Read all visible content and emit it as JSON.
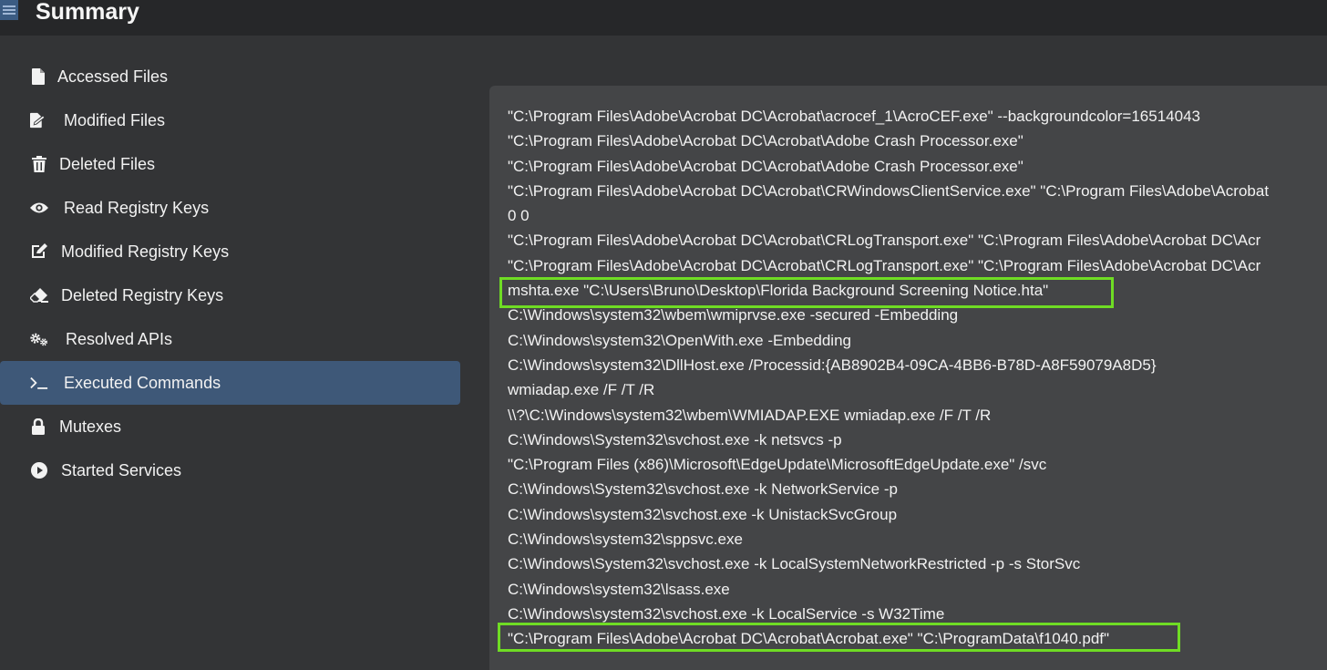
{
  "header": {
    "title": "Summary",
    "menu_icon": "hamburger-menu-icon"
  },
  "sidebar": {
    "items": [
      {
        "label": "Accessed Files",
        "icon": "file-icon"
      },
      {
        "label": "Modified Files",
        "icon": "file-edit-icon"
      },
      {
        "label": "Deleted Files",
        "icon": "trash-icon"
      },
      {
        "label": "Read Registry Keys",
        "icon": "eye-icon"
      },
      {
        "label": "Modified Registry Keys",
        "icon": "pencil-square-icon"
      },
      {
        "label": "Deleted Registry Keys",
        "icon": "eraser-icon"
      },
      {
        "label": "Resolved APIs",
        "icon": "cogs-icon"
      },
      {
        "label": "Executed Commands",
        "icon": "terminal-icon",
        "active": true
      },
      {
        "label": "Mutexes",
        "icon": "lock-icon"
      },
      {
        "label": "Started Services",
        "icon": "play-circle-icon"
      }
    ]
  },
  "commands": [
    "\"C:\\Program Files\\Adobe\\Acrobat DC\\Acrobat\\acrocef_1\\AcroCEF.exe\" --backgroundcolor=16514043",
    "\"C:\\Program Files\\Adobe\\Acrobat DC\\Acrobat\\Adobe Crash Processor.exe\"",
    "\"C:\\Program Files\\Adobe\\Acrobat DC\\Acrobat\\Adobe Crash Processor.exe\"",
    "\"C:\\Program Files\\Adobe\\Acrobat DC\\Acrobat\\CRWindowsClientService.exe\" \"C:\\Program Files\\Adobe\\Acrobat",
    "0 0",
    "\"C:\\Program Files\\Adobe\\Acrobat DC\\Acrobat\\CRLogTransport.exe\" \"C:\\Program Files\\Adobe\\Acrobat DC\\Acr",
    "\"C:\\Program Files\\Adobe\\Acrobat DC\\Acrobat\\CRLogTransport.exe\" \"C:\\Program Files\\Adobe\\Acrobat DC\\Acr",
    "mshta.exe \"C:\\Users\\Bruno\\Desktop\\Florida Background Screening Notice.hta\"",
    "C:\\Windows\\system32\\wbem\\wmiprvse.exe -secured -Embedding",
    "C:\\Windows\\system32\\OpenWith.exe -Embedding",
    "C:\\Windows\\system32\\DllHost.exe /Processid:{AB8902B4-09CA-4BB6-B78D-A8F59079A8D5}",
    "wmiadap.exe /F /T /R",
    "\\\\?\\C:\\Windows\\system32\\wbem\\WMIADAP.EXE wmiadap.exe /F /T /R",
    "C:\\Windows\\System32\\svchost.exe -k netsvcs -p",
    "\"C:\\Program Files (x86)\\Microsoft\\EdgeUpdate\\MicrosoftEdgeUpdate.exe\" /svc",
    "C:\\Windows\\System32\\svchost.exe -k NetworkService -p",
    "C:\\Windows\\system32\\svchost.exe -k UnistackSvcGroup",
    "C:\\Windows\\system32\\sppsvc.exe",
    "C:\\Windows\\System32\\svchost.exe -k LocalSystemNetworkRestricted -p -s StorSvc",
    "C:\\Windows\\system32\\lsass.exe",
    "C:\\Windows\\system32\\svchost.exe -k LocalService -s W32Time",
    "\"C:\\Program Files\\Adobe\\Acrobat DC\\Acrobat\\Acrobat.exe\" \"C:\\ProgramData\\f1040.pdf\""
  ],
  "highlight_color": "#6fdc24",
  "active_color": "#3e5878"
}
